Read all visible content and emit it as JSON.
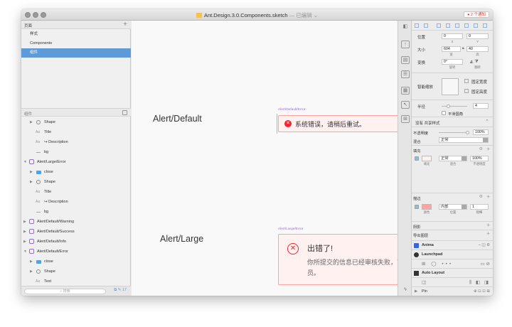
{
  "window": {
    "title": "Ant.Design.3.0.Components.sketch",
    "edited": "— 已编辑 ⌄",
    "notifications": "● 2 个通知"
  },
  "pages": {
    "header": "页面",
    "items": [
      {
        "label": "样式"
      },
      {
        "label": "Components"
      },
      {
        "label": "组件"
      }
    ]
  },
  "layers": {
    "header": "组件",
    "items": [
      {
        "label": "Shape"
      },
      {
        "label": "Title"
      },
      {
        "label": "↪ Description"
      },
      {
        "label": "bg"
      },
      {
        "label": "Alert/Large/Error"
      },
      {
        "label": "close"
      },
      {
        "label": "Shape"
      },
      {
        "label": "Title"
      },
      {
        "label": "↪ Description"
      },
      {
        "label": "bg"
      },
      {
        "label": "Alert/Default/Warning"
      },
      {
        "label": "Alert/Default/Success"
      },
      {
        "label": "Alert/Default/Info"
      },
      {
        "label": "Alert/Default/Error"
      },
      {
        "label": "close"
      },
      {
        "label": "Shape"
      },
      {
        "label": "Text"
      },
      {
        "label": "bg"
      }
    ]
  },
  "search": {
    "placeholder": "搜索"
  },
  "canvas": {
    "label_default": "Alert/Default",
    "label_large": "Alert/Large",
    "artboard_default": "Alert/Default/Error",
    "artboard_large": "Alert/Large/Error",
    "alert_default_text": "系统错误，请稍后重试。",
    "alert_large_title": "出错了!",
    "alert_large_desc": "你所提交的信息已经审核失败，可以联系客服人员。",
    "error_color": "#f5222d"
  },
  "inspector": {
    "position": {
      "label": "位置",
      "x": "0",
      "y": "0",
      "x_sub": "X",
      "y_sub": "Y"
    },
    "size": {
      "label": "大小",
      "w": "604",
      "h": "40",
      "w_sub": "宽",
      "h_sub": "高"
    },
    "transform": {
      "label": "变换",
      "rotate": "0°",
      "rotate_sub": "旋转",
      "flip_sub": "翻转"
    },
    "resizing": {
      "label": "智能缩放",
      "fixed_width": "固定宽度",
      "fixed_height": "固定高度"
    },
    "radius": {
      "label": "半径",
      "value": "4",
      "smooth": "平滑圆角"
    },
    "style": {
      "value": "没有 共享样式"
    },
    "opacity": {
      "label": "不透明度",
      "value": "100%"
    },
    "blend": {
      "label": "混合",
      "value": "正常"
    },
    "fill": {
      "label": "填充",
      "mode": "正常",
      "opacity": "100%",
      "sub_fill": "填充",
      "sub_blend": "混合",
      "sub_opacity": "不透明度",
      "color": "#fff1f0"
    },
    "border": {
      "label": "描边",
      "position": "内部",
      "width": "1",
      "sub_color": "颜色",
      "sub_position": "位置",
      "sub_width": "粗细",
      "color": "#ffa39e"
    },
    "shadow": {
      "label": "阴影"
    },
    "export": {
      "label": "导出图层"
    },
    "plugins": [
      {
        "name": "Anima",
        "color": "#3b64d6"
      },
      {
        "name": "Launchpad",
        "color": "#333333"
      },
      {
        "name": "Auto Layout",
        "color": "#333333"
      },
      {
        "name": "Pin",
        "color": "#888888"
      }
    ]
  }
}
